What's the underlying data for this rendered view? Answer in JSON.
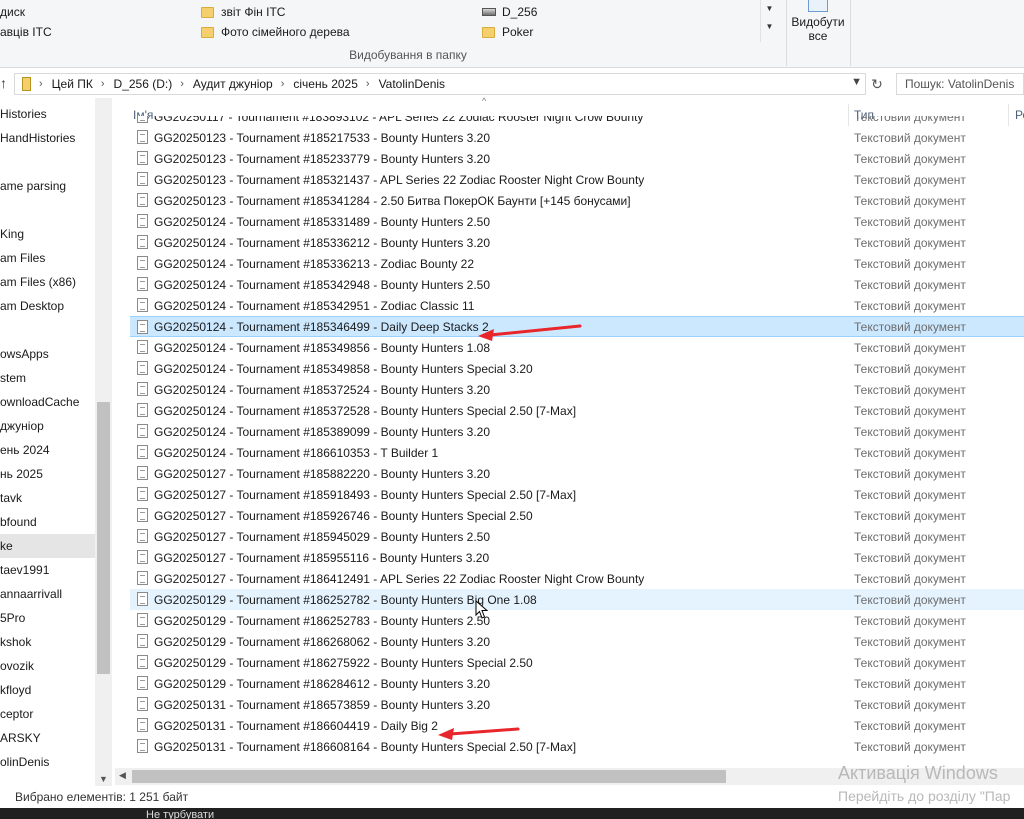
{
  "ribbon": {
    "items": [
      {
        "label": "диск",
        "icon": "drive-icon"
      },
      {
        "label": "авців ІТС",
        "icon": "none"
      },
      {
        "label": "звіт Фін ІТС",
        "icon": "folder-icon"
      },
      {
        "label": "Фото сімейного дерева",
        "icon": "folder-icon"
      },
      {
        "label": "D_256",
        "icon": "drive-icon"
      },
      {
        "label": "Poker",
        "icon": "folder-icon"
      }
    ],
    "select_all_label": "Видобути все",
    "group_label": "Видобування в папку"
  },
  "address": {
    "crumbs": [
      "Цей ПК",
      "D_256 (D:)",
      "Аудит джуніор",
      "січень 2025",
      "VatolinDenis"
    ],
    "search_placeholder": "Пошук: VatolinDenis"
  },
  "nav": {
    "items": [
      "Histories",
      "HandHistories",
      "",
      "ame parsing",
      "",
      "King",
      "am Files",
      "am Files (x86)",
      "am Desktop",
      "",
      "owsApps",
      "stem",
      "ownloadCache",
      "джуніор",
      "ень 2024",
      "нь 2025",
      "tavk",
      "bfound",
      "ke",
      "taev1991",
      "annaarrivall",
      "5Pro",
      "kshok",
      "ovozik",
      "kfloyd",
      "ceptor",
      "ARSKY",
      "olinDenis"
    ],
    "selected_index": 18
  },
  "columns": {
    "name": "Ім'я",
    "type": "Тип",
    "third": "Ро"
  },
  "files": [
    {
      "name": "GG20250117 - Tournament #183893102 - APL Series 22 Zodiac Rooster Night Crow Bounty",
      "type": "Текстовий документ"
    },
    {
      "name": "GG20250123 - Tournament #185217533 - Bounty Hunters 3.20",
      "type": "Текстовий документ"
    },
    {
      "name": "GG20250123 - Tournament #185233779 - Bounty Hunters 3.20",
      "type": "Текстовий документ"
    },
    {
      "name": "GG20250123 - Tournament #185321437 - APL Series 22 Zodiac Rooster Night Crow Bounty",
      "type": "Текстовий документ"
    },
    {
      "name": "GG20250123 - Tournament #185341284 - 2.50 Битва ПокерОК Баунти [+145 бонусами]",
      "type": "Текстовий документ"
    },
    {
      "name": "GG20250124 - Tournament #185331489 - Bounty Hunters 2.50",
      "type": "Текстовий документ"
    },
    {
      "name": "GG20250124 - Tournament #185336212 - Bounty Hunters 3.20",
      "type": "Текстовий документ"
    },
    {
      "name": "GG20250124 - Tournament #185336213 - Zodiac Bounty 22",
      "type": "Текстовий документ"
    },
    {
      "name": "GG20250124 - Tournament #185342948 - Bounty Hunters 2.50",
      "type": "Текстовий документ"
    },
    {
      "name": "GG20250124 - Tournament #185342951 - Zodiac Classic 11",
      "type": "Текстовий документ"
    },
    {
      "name": "GG20250124 - Tournament #185346499 - Daily Deep Stacks 2",
      "type": "Текстовий документ"
    },
    {
      "name": "GG20250124 - Tournament #185349856 - Bounty Hunters 1.08",
      "type": "Текстовий документ"
    },
    {
      "name": "GG20250124 - Tournament #185349858 - Bounty Hunters Special 3.20",
      "type": "Текстовий документ"
    },
    {
      "name": "GG20250124 - Tournament #185372524 - Bounty Hunters 3.20",
      "type": "Текстовий документ"
    },
    {
      "name": "GG20250124 - Tournament #185372528 - Bounty Hunters Special 2.50 [7-Max]",
      "type": "Текстовий документ"
    },
    {
      "name": "GG20250124 - Tournament #185389099 - Bounty Hunters 3.20",
      "type": "Текстовий документ"
    },
    {
      "name": "GG20250124 - Tournament #186610353 - T Builder 1",
      "type": "Текстовий документ"
    },
    {
      "name": "GG20250127 - Tournament #185882220 - Bounty Hunters 3.20",
      "type": "Текстовий документ"
    },
    {
      "name": "GG20250127 - Tournament #185918493 - Bounty Hunters Special 2.50 [7-Max]",
      "type": "Текстовий документ"
    },
    {
      "name": "GG20250127 - Tournament #185926746 - Bounty Hunters Special 2.50",
      "type": "Текстовий документ"
    },
    {
      "name": "GG20250127 - Tournament #185945029 - Bounty Hunters 2.50",
      "type": "Текстовий документ"
    },
    {
      "name": "GG20250127 - Tournament #185955116 - Bounty Hunters 3.20",
      "type": "Текстовий документ"
    },
    {
      "name": "GG20250127 - Tournament #186412491 - APL Series 22 Zodiac Rooster Night Crow Bounty",
      "type": "Текстовий документ"
    },
    {
      "name": "GG20250129 - Tournament #186252782 - Bounty Hunters Big One 1.08",
      "type": "Текстовий документ"
    },
    {
      "name": "GG20250129 - Tournament #186252783 - Bounty Hunters 2.50",
      "type": "Текстовий документ"
    },
    {
      "name": "GG20250129 - Tournament #186268062 - Bounty Hunters 3.20",
      "type": "Текстовий документ"
    },
    {
      "name": "GG20250129 - Tournament #186275922 - Bounty Hunters Special 2.50",
      "type": "Текстовий документ"
    },
    {
      "name": "GG20250129 - Tournament #186284612 - Bounty Hunters 3.20",
      "type": "Текстовий документ"
    },
    {
      "name": "GG20250131 - Tournament #186573859 - Bounty Hunters 3.20",
      "type": "Текстовий документ"
    },
    {
      "name": "GG20250131 - Tournament #186604419 - Daily Big 2",
      "type": "Текстовий документ"
    },
    {
      "name": "GG20250131 - Tournament #186608164 - Bounty Hunters Special 2.50 [7-Max]",
      "type": "Текстовий документ"
    }
  ],
  "selected_row": 10,
  "hover_row": 23,
  "status": {
    "text": "Вибрано елементів: 1  251 байт"
  },
  "taskbar": {
    "text": "Не турбувати"
  },
  "watermark": {
    "title": "Активація Windows",
    "subtitle": "Перейдіть до розділу \"Пар"
  },
  "annotation_color": "#e8262b"
}
